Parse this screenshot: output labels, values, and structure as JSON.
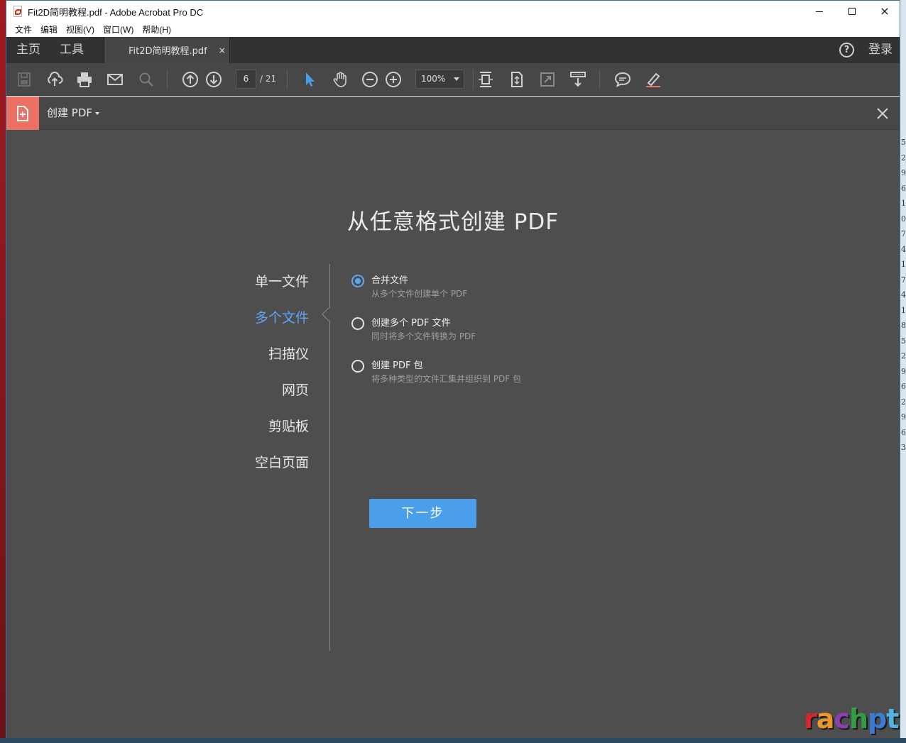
{
  "window": {
    "title": "Fit2D简明教程.pdf - Adobe Acrobat Pro DC",
    "controls": {
      "minimize": "minimize",
      "maximize": "maximize",
      "close": "×"
    }
  },
  "menubar": {
    "items": [
      "文件",
      "编辑",
      "视图(V)",
      "窗口(W)",
      "帮助(H)"
    ]
  },
  "tabs": {
    "home": "主页",
    "tools": "工具",
    "document": "Fit2D简明教程.pdf",
    "document_close": "×",
    "help": "?",
    "login": "登录"
  },
  "toolbar": {
    "page_current": "6",
    "page_total": "/ 21",
    "zoom": "100%",
    "icons": [
      "save-icon",
      "upload-icon",
      "print-icon",
      "mail-icon",
      "search-icon",
      "prev-page-icon",
      "next-page-icon",
      "select-arrow-icon",
      "hand-icon",
      "zoom-out-icon",
      "zoom-in-icon",
      "fit-page-icon",
      "scroll-mode-icon",
      "fullscreen-icon",
      "read-mode-icon",
      "comment-icon",
      "highlight-pen-icon"
    ],
    "accent": "#4a9eea"
  },
  "create_panel": {
    "title": "创建 PDF",
    "icon_color": "#ec7164",
    "close": "close-icon"
  },
  "main": {
    "heading": "从任意格式创建 PDF",
    "sidebar": [
      {
        "label": "单一文件",
        "active": false
      },
      {
        "label": "多个文件",
        "active": true
      },
      {
        "label": "扫描仪",
        "active": false
      },
      {
        "label": "网页",
        "active": false
      },
      {
        "label": "剪贴板",
        "active": false
      },
      {
        "label": "空白页面",
        "active": false
      }
    ],
    "options": [
      {
        "label": "合并文件",
        "desc": "从多个文件创建单个 PDF",
        "checked": true
      },
      {
        "label": "创建多个 PDF 文件",
        "desc": "同时将多个文件转换为 PDF",
        "checked": false
      },
      {
        "label": "创建 PDF 包",
        "desc": "将多种类型的文件汇集并组织到 PDF 包",
        "checked": false
      }
    ],
    "next_button": "下一步"
  },
  "watermark": {
    "letters": [
      "r",
      "a",
      "c",
      "h",
      "p",
      "t"
    ],
    "colors": [
      "#d8262e",
      "#e9982a",
      "#8c3fb0",
      "#2f9e44",
      "#3a7bd5",
      "#4fb3e0"
    ]
  },
  "desktop_strip": [
    "5",
    "2",
    "9",
    "6",
    "1",
    "0",
    "7",
    "4",
    "1",
    "7",
    "4",
    "1",
    "8",
    "5",
    "2",
    "9",
    "6",
    "2",
    "9",
    "6",
    "3"
  ]
}
